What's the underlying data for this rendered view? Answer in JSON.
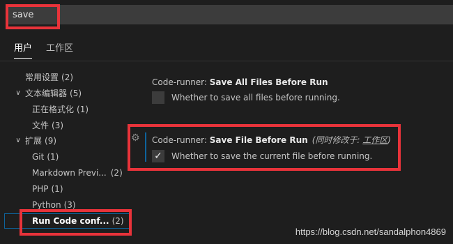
{
  "search": {
    "value": "save"
  },
  "tabs": [
    {
      "label": "用户",
      "active": true
    },
    {
      "label": "工作区",
      "active": false
    }
  ],
  "tree": [
    {
      "label": "常用设置",
      "count": "(2)",
      "indent": 0,
      "chevron": ""
    },
    {
      "label": "文本编辑器",
      "count": "(5)",
      "indent": 0,
      "chevron": "∨"
    },
    {
      "label": "正在格式化",
      "count": "(1)",
      "indent": 1,
      "chevron": ""
    },
    {
      "label": "文件",
      "count": "(3)",
      "indent": 1,
      "chevron": ""
    },
    {
      "label": "扩展",
      "count": "(9)",
      "indent": 0,
      "chevron": "∨"
    },
    {
      "label": "Git",
      "count": "(1)",
      "indent": 1,
      "chevron": ""
    },
    {
      "label": "Markdown Previ...",
      "count": "(2)",
      "indent": 1,
      "chevron": ""
    },
    {
      "label": "PHP",
      "count": "(1)",
      "indent": 1,
      "chevron": ""
    },
    {
      "label": "Python",
      "count": "(3)",
      "indent": 1,
      "chevron": ""
    },
    {
      "label": "Run Code conf...",
      "count": "(2)",
      "indent": 1,
      "chevron": "",
      "selected": true
    }
  ],
  "settings": [
    {
      "prefix": "Code-runner: ",
      "name": "Save All Files Before Run",
      "description": "Whether to save all files before running.",
      "checked": false
    },
    {
      "prefix": "Code-runner: ",
      "name": "Save File Before Run",
      "modified_prefix": "(同时修改于: ",
      "modified_ws": "工作区",
      "modified_suffix": ")",
      "description": "Whether to save the current file before running.",
      "checked": true
    }
  ],
  "icons": {
    "gear": "gear-icon",
    "checkmark": "checkmark-icon"
  },
  "colors": {
    "highlight": "#e8333a",
    "accent": "#0e639c"
  },
  "watermark": "https://blog.csdn.net/sandalphon4869"
}
